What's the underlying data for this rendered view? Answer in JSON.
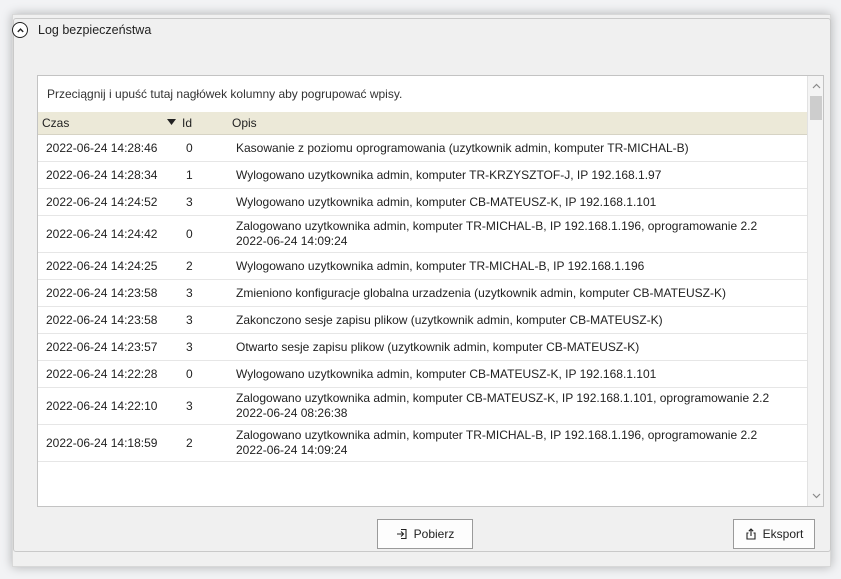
{
  "panel": {
    "title": "Log bezpieczeństwa",
    "collapse_icon": "chevron-up-circle-icon"
  },
  "grid": {
    "group_hint": "Przeciągnij i upuść tutaj nagłówek kolumny aby pogrupować wpisy.",
    "columns": [
      "Czas",
      "Id",
      "Opis"
    ],
    "sort_icon": "sort-descending-icon",
    "rows": [
      {
        "time": "2022-06-24 14:28:46",
        "id": "0",
        "desc": "Kasowanie z poziomu oprogramowania (uzytkownik admin, komputer TR-MICHAL-B)",
        "desc2": ""
      },
      {
        "time": "2022-06-24 14:28:34",
        "id": "1",
        "desc": "Wylogowano uzytkownika admin, komputer TR-KRZYSZTOF-J, IP 192.168.1.97",
        "desc2": ""
      },
      {
        "time": "2022-06-24 14:24:52",
        "id": "3",
        "desc": "Wylogowano uzytkownika admin, komputer CB-MATEUSZ-K, IP 192.168.1.101",
        "desc2": ""
      },
      {
        "time": "2022-06-24 14:24:42",
        "id": "0",
        "desc": "Zalogowano uzytkownika admin, komputer TR-MICHAL-B, IP 192.168.1.196, oprogramowanie 2.2",
        "desc2": "2022-06-24 14:09:24"
      },
      {
        "time": "2022-06-24 14:24:25",
        "id": "2",
        "desc": "Wylogowano uzytkownika admin, komputer TR-MICHAL-B, IP 192.168.1.196",
        "desc2": ""
      },
      {
        "time": "2022-06-24 14:23:58",
        "id": "3",
        "desc": "Zmieniono konfiguracje globalna urzadzenia (uzytkownik admin, komputer CB-MATEUSZ-K)",
        "desc2": ""
      },
      {
        "time": "2022-06-24 14:23:58",
        "id": "3",
        "desc": "Zakonczono sesje zapisu plikow (uzytkownik admin, komputer CB-MATEUSZ-K)",
        "desc2": ""
      },
      {
        "time": "2022-06-24 14:23:57",
        "id": "3",
        "desc": "Otwarto sesje zapisu plikow (uzytkownik admin, komputer CB-MATEUSZ-K)",
        "desc2": ""
      },
      {
        "time": "2022-06-24 14:22:28",
        "id": "0",
        "desc": "Wylogowano uzytkownika admin, komputer CB-MATEUSZ-K, IP 192.168.1.101",
        "desc2": ""
      },
      {
        "time": "2022-06-24 14:22:10",
        "id": "3",
        "desc": "Zalogowano uzytkownika admin, komputer CB-MATEUSZ-K, IP 192.168.1.101, oprogramowanie 2.2",
        "desc2": "2022-06-24 08:26:38"
      },
      {
        "time": "2022-06-24 14:18:59",
        "id": "2",
        "desc": "Zalogowano uzytkownika admin, komputer TR-MICHAL-B, IP 192.168.1.196, oprogramowanie 2.2",
        "desc2": "2022-06-24 14:09:24"
      }
    ]
  },
  "buttons": {
    "download_label": "Pobierz",
    "download_icon": "sign-in-icon",
    "export_label": "Eksport",
    "export_icon": "share-upload-icon"
  }
}
